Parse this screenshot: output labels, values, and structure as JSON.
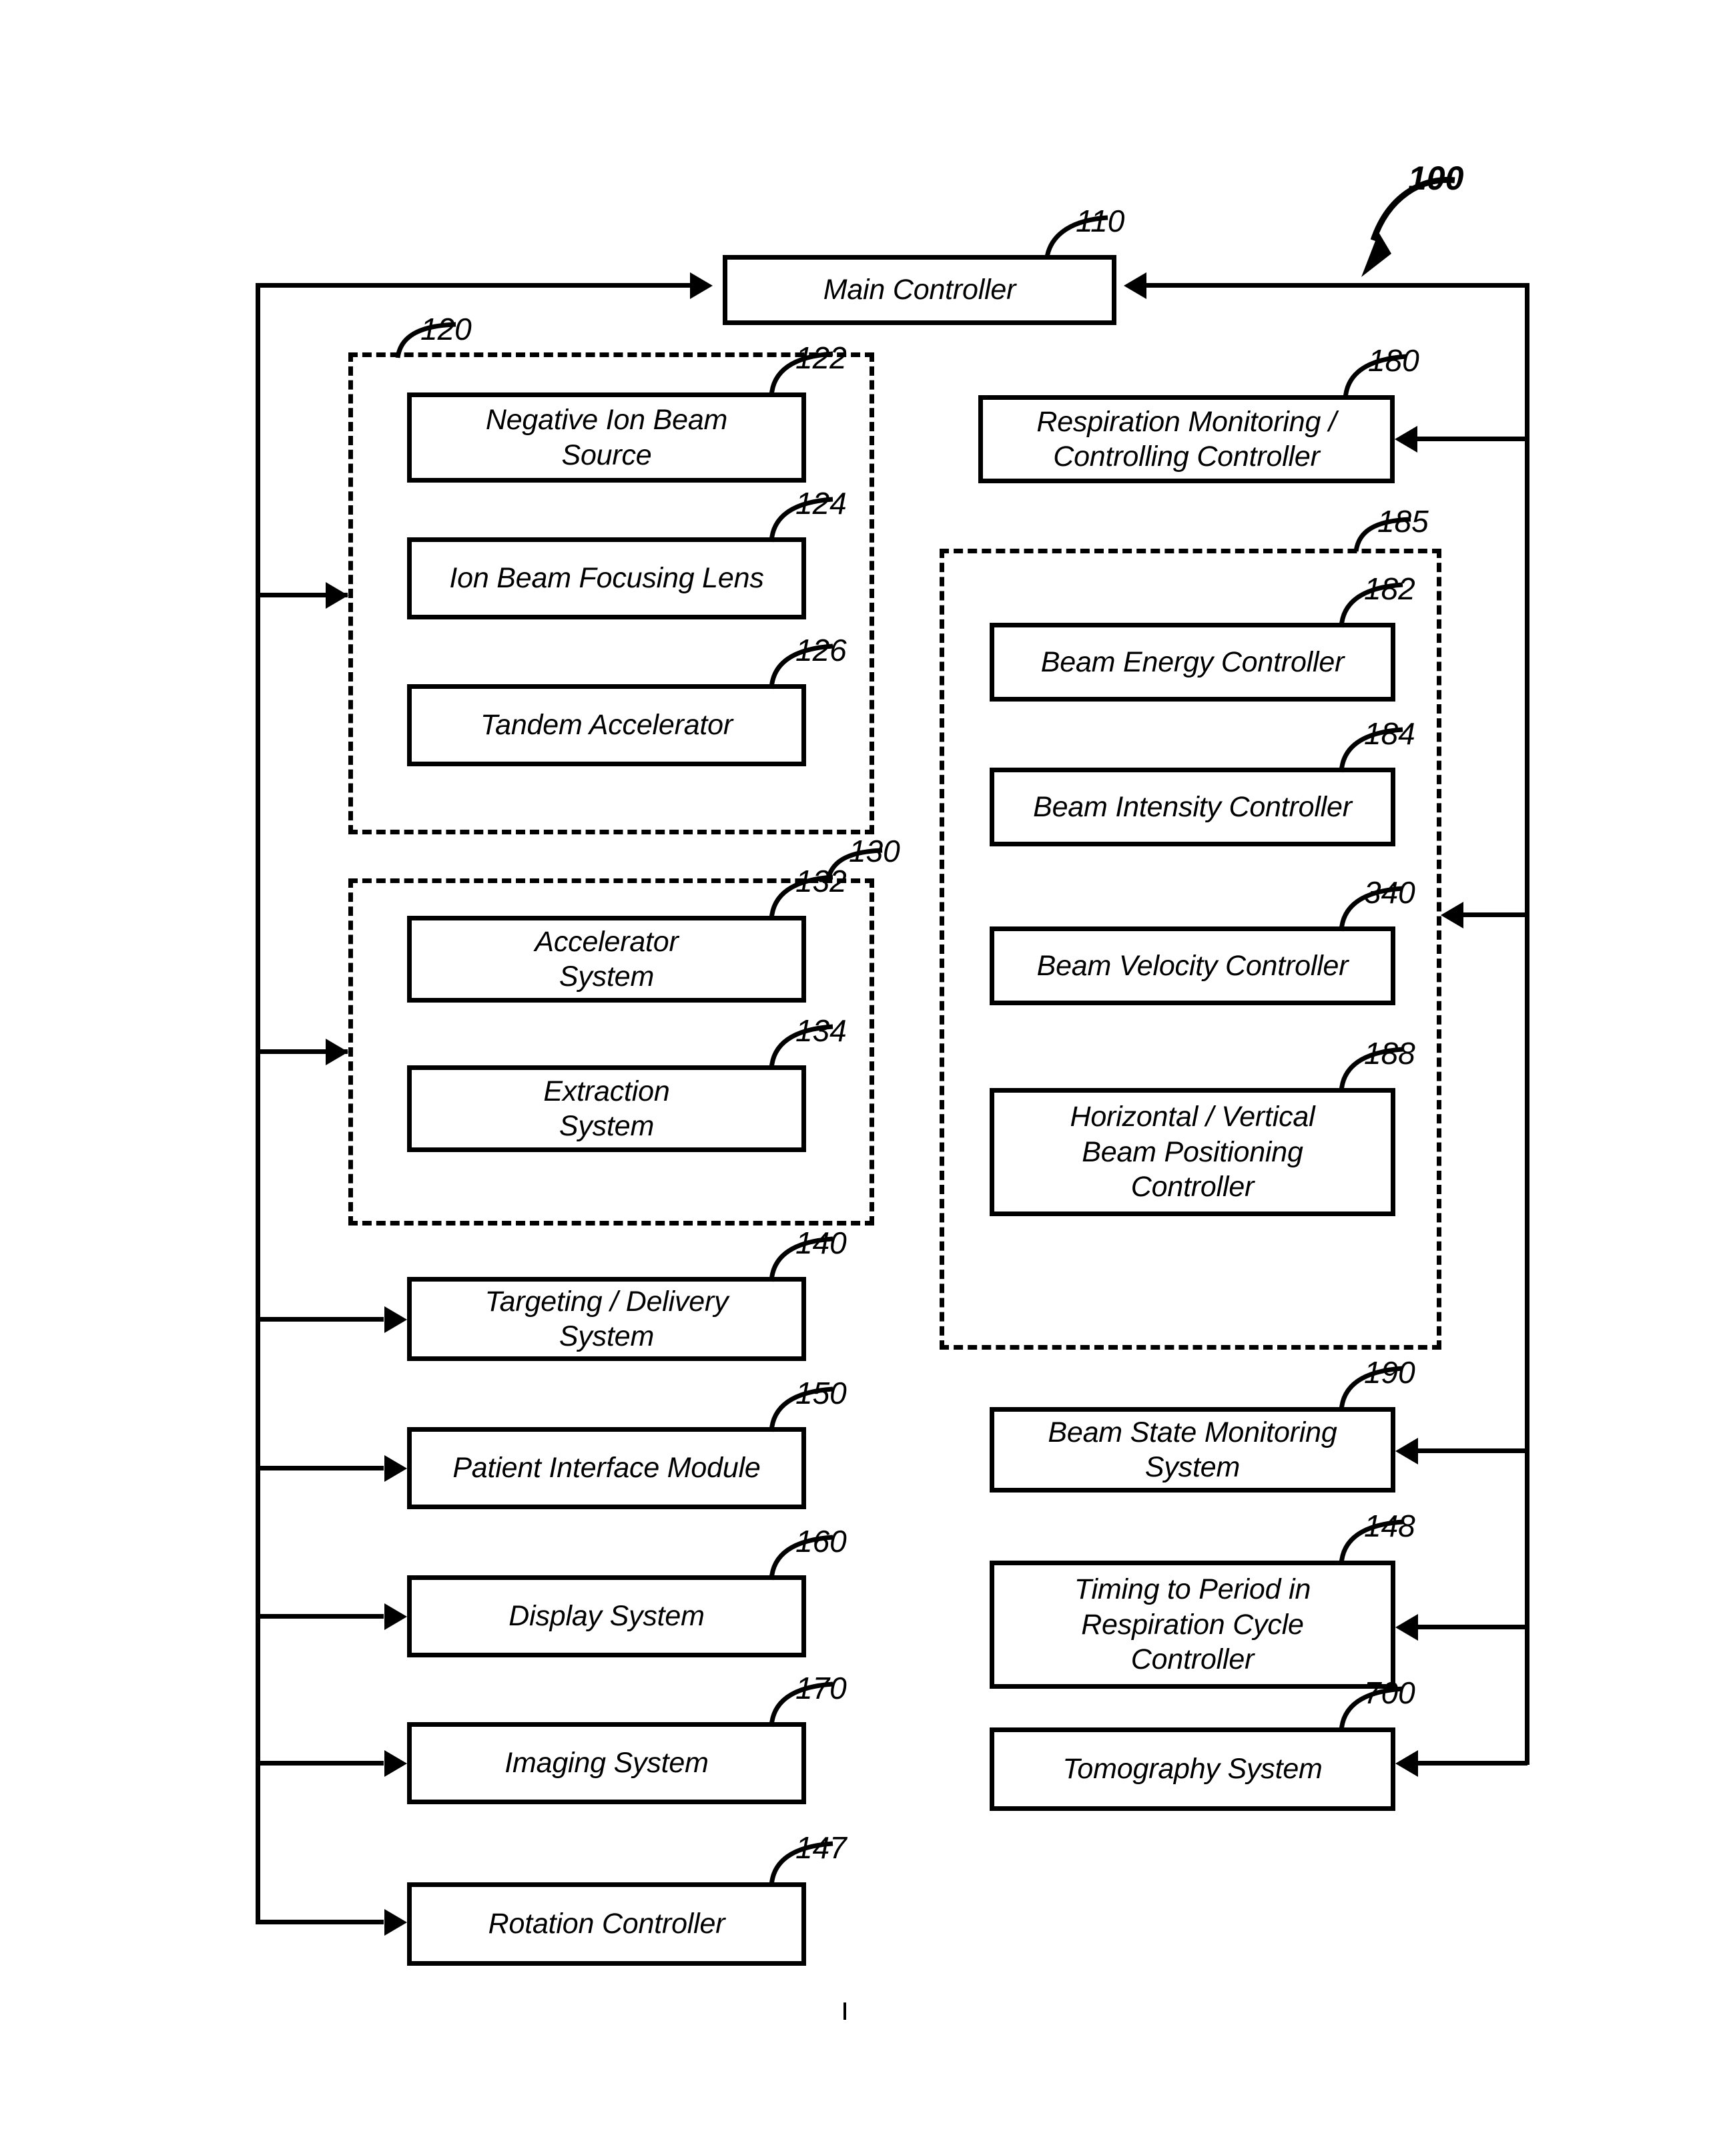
{
  "figure": {
    "system_ref": "100",
    "main_controller": {
      "label": "Main Controller",
      "ref": "110"
    },
    "left_groups": [
      {
        "ref": "120",
        "boxes": [
          {
            "ref": "122",
            "label": "Negative Ion Beam\nSource"
          },
          {
            "ref": "124",
            "label": "Ion Beam Focusing Lens"
          },
          {
            "ref": "126",
            "label": "Tandem Accelerator"
          }
        ]
      },
      {
        "ref": "130",
        "boxes": [
          {
            "ref": "132",
            "label": "Accelerator\nSystem"
          },
          {
            "ref": "134",
            "label": "Extraction\nSystem"
          }
        ]
      }
    ],
    "left_boxes": [
      {
        "ref": "140",
        "label": "Targeting / Delivery\nSystem"
      },
      {
        "ref": "150",
        "label": "Patient Interface Module"
      },
      {
        "ref": "160",
        "label": "Display System"
      },
      {
        "ref": "170",
        "label": "Imaging System"
      },
      {
        "ref": "147",
        "label": "Rotation Controller"
      }
    ],
    "right_top_box": {
      "ref": "180",
      "label": "Respiration Monitoring /\nControlling Controller"
    },
    "right_group": {
      "ref": "185",
      "boxes": [
        {
          "ref": "182",
          "label": "Beam Energy Controller"
        },
        {
          "ref": "184",
          "label": "Beam Intensity Controller"
        },
        {
          "ref": "340",
          "label": "Beam Velocity Controller"
        },
        {
          "ref": "188",
          "label": "Horizontal / Vertical\nBeam Positioning\nController"
        }
      ]
    },
    "right_bottom_boxes": [
      {
        "ref": "190",
        "label": "Beam State Monitoring\nSystem"
      },
      {
        "ref": "148",
        "label": "Timing to Period in\nRespiration Cycle\nController"
      },
      {
        "ref": "700",
        "label": "Tomography System"
      }
    ]
  },
  "colors": {
    "ink": "#000000",
    "paper": "#ffffff"
  }
}
